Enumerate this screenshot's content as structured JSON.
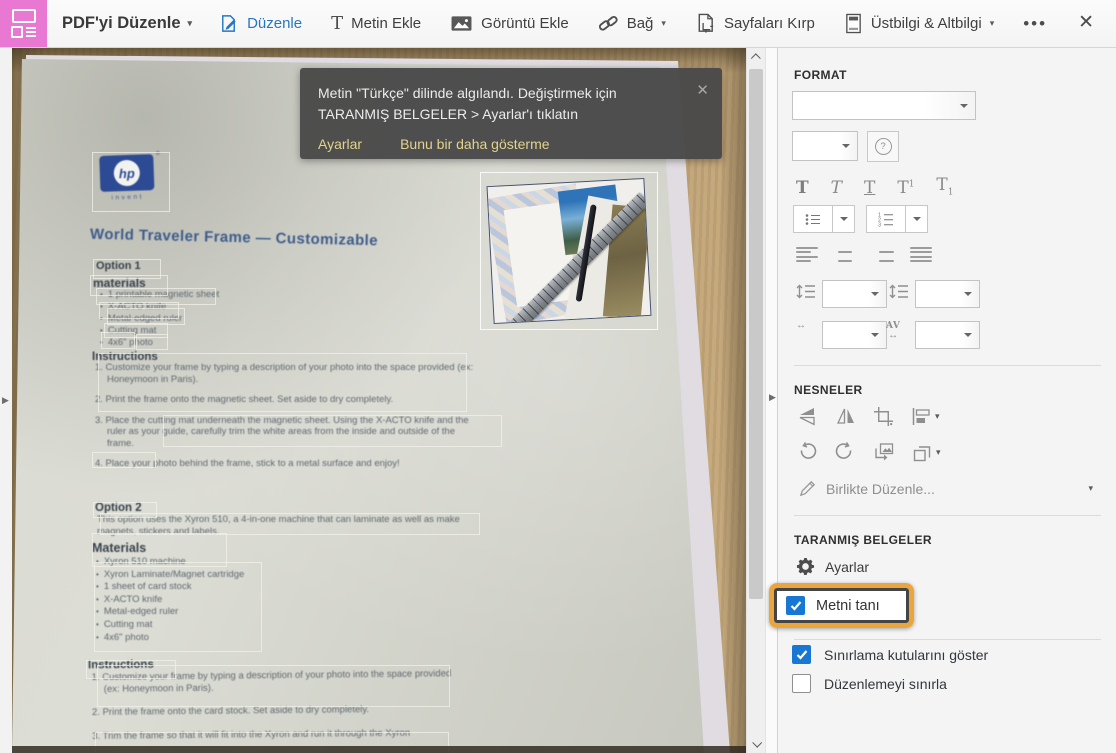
{
  "toolbar": {
    "title": "PDF'yi Düzenle",
    "items": {
      "edit": "Düzenle",
      "add_text": "Metin Ekle",
      "add_image": "Görüntü Ekle",
      "link": "Bağ",
      "crop_pages": "Sayfaları Kırp",
      "header_footer": "Üstbilgi & Altbilgi"
    }
  },
  "glyphs": {
    "caret": "▾",
    "close": "✕",
    "more": "•••",
    "text_tool": "T",
    "question": "?",
    "arrow_right": "▶",
    "tee": "T",
    "sup": "1",
    "sub": "1",
    "harrow": "↔",
    "av": "AV"
  },
  "toast": {
    "message": "Metin \"Türkçe\" dilinde algılandı. Değiştirmek için TARANMIŞ BELGELER > Ayarlar'ı tıklatın",
    "settings_link": "Ayarlar",
    "dismiss_link": "Bunu bir daha gösterme",
    "close": "✕"
  },
  "document": {
    "logo": {
      "hp": "hp",
      "invent": "invent",
      "reg": "®"
    },
    "title": "World Traveler Frame — Customizable",
    "option1": {
      "heading": "Option 1",
      "materials_heading": "materials",
      "materials": [
        "1 printable magnetic sheet",
        "X-ACTO knife",
        "Metal-edged ruler",
        "Cutting mat",
        "4x6\" photo"
      ],
      "instructions_heading": "Instructions",
      "instructions": [
        "1. Customize your frame by typing a description of your photo into the space provided (ex: Honeymoon in Paris).",
        "2. Print the frame onto the magnetic sheet. Set aside to dry completely.",
        "3. Place the cutting mat underneath the magnetic sheet. Using the X-ACTO knife and the ruler as your guide, carefully trim the white areas from the inside and outside of the frame.",
        "4. Place your photo behind the frame, stick to a metal surface and enjoy!"
      ]
    },
    "option2": {
      "heading": "Option 2",
      "description": "This option uses the Xyron 510, a 4-in-one machine that can laminate as well as make magnets, stickers and labels.",
      "materials_heading": "Materials",
      "materials": [
        "Xyron 510 machine",
        "Xyron Laminate/Magnet cartridge",
        "1 sheet of card stock",
        "X-ACTO knife",
        "Metal-edged ruler",
        "Cutting mat",
        "4x6\" photo"
      ],
      "instructions_heading": "Instructions",
      "instructions": [
        "1. Customize your frame by typing a description of your photo into the space provided (ex: Honeymoon in Paris).",
        "2. Print the frame onto the card stock. Set aside to dry completely.",
        "3. Trim the frame so that it will fit into the Xyron and run it through the Xyron"
      ]
    }
  },
  "panel": {
    "format_title": "FORMAT",
    "objects_title": "NESNELER",
    "edit_using": "Birlikte Düzenle...",
    "scanned_title": "TARANMIŞ BELGELER",
    "settings": "Ayarlar",
    "recognize_text": "Metni tanı",
    "show_bounding_boxes": "Sınırlama kutularını göster",
    "limit_editing": "Düzenlemeyi sınırla"
  },
  "colors": {
    "accent_blue": "#2577c0",
    "checkbox_blue": "#1877d2",
    "highlight_orange": "#eaa63c",
    "tool_pink": "#e878d2",
    "toast_link_yellow": "#e3d38b"
  }
}
